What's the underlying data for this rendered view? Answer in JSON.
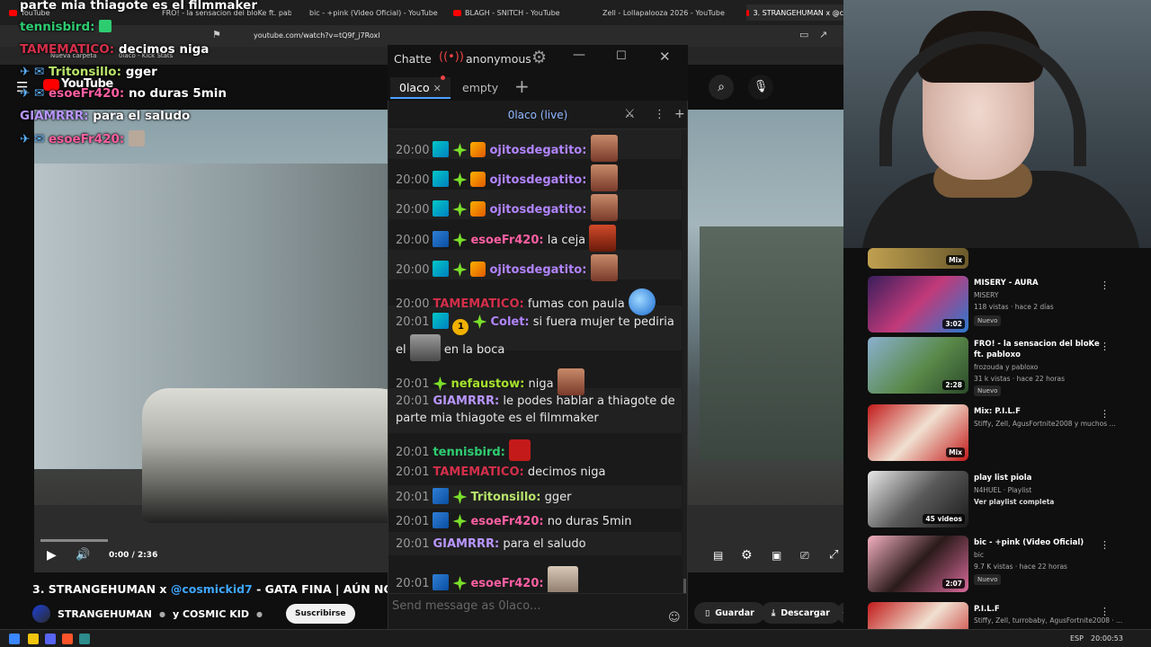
{
  "browser": {
    "tabs": [
      {
        "label": "YouTube"
      },
      {
        "label": "FRO! - la sensacion del bloKe ft. pabl"
      },
      {
        "label": "bic - +pink (Video Oficial) - YouTube"
      },
      {
        "label": "BLAGH - SNITCH - YouTube"
      },
      {
        "label": "Zell - Lollapalooza 2026 - YouTube"
      },
      {
        "label": "3. STRANGEHUMAN x @c"
      }
    ],
    "url": "youtube.com/watch?v=tQ9f_j7Roxl",
    "bookmarks": [
      {
        "label": "Nueva carpeta"
      },
      {
        "label": "0laco - Kick Stats"
      }
    ]
  },
  "youtube": {
    "logo": "YouTube",
    "time": "0:00 / 2:36",
    "video_title_prefix": "3. STRANGEHUMAN x ",
    "video_title_link": "@cosmickid7",
    "video_title_suffix": " - GATA FINA | AÚN NO HE TE",
    "channel": "STRANGEHUMAN",
    "channel_joint": "y COSMIC KID",
    "subscribe": "Suscribirse",
    "save": "Guardar",
    "download": "Descargar"
  },
  "overlay": [
    {
      "user": "",
      "text": "parte mia thiagote es el filmmaker",
      "color": "#ffffff"
    },
    {
      "user": "tennisbird:",
      "text": "",
      "color": "#2ecc71"
    },
    {
      "user": "TAMEMATICO:",
      "text": "decimos niga",
      "color": "#d32f4a"
    },
    {
      "user": "Tritonsillo:",
      "text": "gger",
      "color": "#b7e36a"
    },
    {
      "user": "esoeFr420:",
      "text": "no duras 5min",
      "color": "#ff5fa2"
    },
    {
      "user": "GIAMRRR:",
      "text": "para el saludo",
      "color": "#b896ff"
    },
    {
      "user": "esoeFr420:",
      "text": "",
      "color": "#ff5fa2"
    }
  ],
  "chatterino": {
    "title": "Chatte",
    "account": "anonymous",
    "tabs": [
      {
        "label": "0laco"
      },
      {
        "label": "empty"
      }
    ],
    "channel": "0laco (live)",
    "input_placeholder": "Send message as 0laco...",
    "messages": [
      {
        "time": "20:00",
        "badges": [
          "sub",
          "prime",
          "cube"
        ],
        "user": "ojitosdegatito:",
        "color": "#b184ff",
        "text": "",
        "emote": "face"
      },
      {
        "time": "20:00",
        "badges": [
          "sub",
          "prime",
          "cube"
        ],
        "user": "ojitosdegatito:",
        "color": "#b184ff",
        "text": "",
        "emote": "face"
      },
      {
        "time": "20:00",
        "badges": [
          "sub",
          "prime",
          "cube"
        ],
        "user": "ojitosdegatito:",
        "color": "#b184ff",
        "text": "",
        "emote": "face"
      },
      {
        "time": "20:00",
        "badges": [
          "vip",
          "prime"
        ],
        "user": "esoeFr420:",
        "color": "#ff5fa2",
        "text": "la ceja",
        "emote": "face-red"
      },
      {
        "time": "20:00",
        "badges": [
          "sub",
          "prime",
          "cube"
        ],
        "user": "ojitosdegatito:",
        "color": "#b184ff",
        "text": "",
        "emote": "face"
      },
      {
        "time": "20:00",
        "badges": [],
        "user": "TAMEMATICO:",
        "color": "#d32f4a",
        "text": "fumas con paula",
        "emote": "blue"
      },
      {
        "time": "20:01",
        "badges": [
          "sub",
          "one",
          "prime"
        ],
        "user": "Colet:",
        "color": "#b184ff",
        "text": "si fuera mujer te pediria",
        "text2_pre": "el",
        "text2_post": "en la boca",
        "emote": "gray"
      },
      {
        "time": "20:01",
        "badges": [
          "prime"
        ],
        "user": "nefaustow:",
        "color": "#a6e22e",
        "text": "niga",
        "emote": "face"
      },
      {
        "time": "20:01",
        "badges": [],
        "user": "GIAMRRR:",
        "color": "#b896ff",
        "text": "le podes hablar a thiagote de",
        "text2": "parte mia thiagote es el filmmaker"
      },
      {
        "time": "20:01",
        "badges": [],
        "user": "tennisbird:",
        "color": "#2ecc71",
        "text": "",
        "emote": "angry"
      },
      {
        "time": "20:01",
        "badges": [],
        "user": "TAMEMATICO:",
        "color": "#d32f4a",
        "text": "decimos niga"
      },
      {
        "time": "20:01",
        "badges": [
          "vip",
          "prime"
        ],
        "user": "Tritonsillo:",
        "color": "#b7e36a",
        "text": "gger"
      },
      {
        "time": "20:01",
        "badges": [
          "vip",
          "prime"
        ],
        "user": "esoeFr420:",
        "color": "#ff5fa2",
        "text": "no duras 5min"
      },
      {
        "time": "20:01",
        "badges": [],
        "user": "GIAMRRR:",
        "color": "#b896ff",
        "text": "para el saludo"
      },
      {
        "time": "20:01",
        "badges": [
          "vip",
          "prime"
        ],
        "user": "esoeFr420:",
        "color": "#ff5fa2",
        "text": "",
        "emote": "cat"
      }
    ]
  },
  "sidebar": [
    {
      "title": "",
      "meta1": "",
      "meta2": "",
      "badge": "Mix",
      "nuevo": ""
    },
    {
      "title": "MISERY - AURA",
      "meta1": "MISERY",
      "meta2": "118 vistas · hace 2 días",
      "badge": "3:02",
      "nuevo": "Nuevo"
    },
    {
      "title": "FRO! - la sensacion del bloKe ft. pabloxo",
      "meta1": "frozouda  y pabloxo",
      "meta2": "31 k vistas · hace 22 horas",
      "badge": "2:28",
      "nuevo": "Nuevo"
    },
    {
      "title": "Mix: P.I.L.F",
      "meta1": "Stiffy, Zell, AgusFortnite2008 y muchos ...",
      "meta2": "",
      "badge": "Mix",
      "nuevo": ""
    },
    {
      "title": "play list piola",
      "meta1": "N4HUEL · Playlist",
      "meta2": "Ver playlist completa",
      "badge": "45 videos",
      "nuevo": ""
    },
    {
      "title": "bic - +pink (Video Oficial)",
      "meta1": "bic",
      "meta2": "9.7 K vistas · hace 22 horas",
      "badge": "2:07",
      "nuevo": "Nuevo"
    },
    {
      "title": "P.I.L.F",
      "meta1": "Stiffy, Zell, turrobaby, AgusFortnite2008 · ...",
      "meta2": "",
      "badge": "",
      "nuevo": ""
    }
  ],
  "taskbar": {
    "lang": "ESP",
    "clock": "20:00:53"
  }
}
